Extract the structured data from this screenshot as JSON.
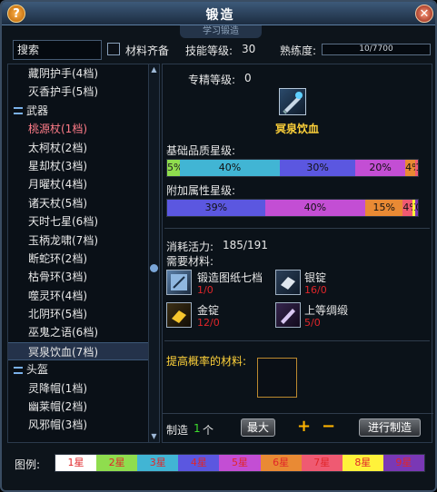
{
  "window": {
    "title": "锻造",
    "subtab": "学习锻造",
    "help_icon": "?"
  },
  "toolbar": {
    "search_value": "搜索",
    "materials_label": "材料齐备",
    "skill_label": "技能等级:",
    "skill_value": "30",
    "proficiency_label": "熟练度:",
    "proficiency_value": "10/7700",
    "proficiency_fraction": 0.0013
  },
  "sidebar": {
    "items": [
      {
        "label": "藏阴护手(4档)",
        "type": "item"
      },
      {
        "label": "灭香护手(5档)",
        "type": "item"
      },
      {
        "label": "武器",
        "type": "category"
      },
      {
        "label": "桃源杖(1档)",
        "type": "item",
        "pink": true
      },
      {
        "label": "太柯杖(2档)",
        "type": "item"
      },
      {
        "label": "星却杖(3档)",
        "type": "item"
      },
      {
        "label": "月曜杖(4档)",
        "type": "item"
      },
      {
        "label": "诸天杖(5档)",
        "type": "item"
      },
      {
        "label": "天时七星(6档)",
        "type": "item"
      },
      {
        "label": "玉柄龙啸(7档)",
        "type": "item"
      },
      {
        "label": "断蛇环(2档)",
        "type": "item"
      },
      {
        "label": "枯骨环(3档)",
        "type": "item"
      },
      {
        "label": "噬灵环(4档)",
        "type": "item"
      },
      {
        "label": "北阴环(5档)",
        "type": "item"
      },
      {
        "label": "巫鬼之语(6档)",
        "type": "item"
      },
      {
        "label": "冥泉饮血(7档)",
        "type": "item",
        "selected": true
      },
      {
        "label": "头盔",
        "type": "category"
      },
      {
        "label": "灵降帽(1档)",
        "type": "item"
      },
      {
        "label": "幽莱帽(2档)",
        "type": "item"
      },
      {
        "label": "风邪帽(3档)",
        "type": "item"
      }
    ]
  },
  "detail": {
    "specialty_label": "专精等级:",
    "specialty_value": "0",
    "item_name": "冥泉饮血",
    "base_quality_label": "基础品质星级:",
    "base_quality": [
      {
        "label": "5%",
        "percent": 5,
        "color": "#8fdd4e"
      },
      {
        "label": "40%",
        "percent": 40,
        "color": "#41b5d4"
      },
      {
        "label": "30%",
        "percent": 30,
        "color": "#5b57e0"
      },
      {
        "label": "20%",
        "percent": 20,
        "color": "#c34ed4"
      },
      {
        "label": "4%",
        "percent": 4,
        "color": "#e98a34"
      },
      {
        "label": "1%",
        "percent": 1,
        "color": "#ef5a72"
      }
    ],
    "extra_quality_label": "附加属性星级:",
    "extra_quality": [
      {
        "label": "39%",
        "percent": 39,
        "color": "#5b57e0"
      },
      {
        "label": "40%",
        "percent": 40,
        "color": "#c34ed4"
      },
      {
        "label": "15%",
        "percent": 15,
        "color": "#e98a34"
      },
      {
        "label": "4%",
        "percent": 4,
        "color": "#ef5a72"
      },
      {
        "label": "1%",
        "percent": 1,
        "color": "#fff23a"
      },
      {
        "label": "0%",
        "percent": 1,
        "color": "#7a38b5"
      }
    ],
    "vitality_label": "消耗活力:",
    "vitality_value": "185/191",
    "materials_label": "需要材料:",
    "materials": [
      {
        "name": "锻造图纸七档",
        "count": "1/0",
        "icon": "blueprint-icon"
      },
      {
        "name": "银锭",
        "count": "16/0",
        "icon": "silver-ingot-icon"
      },
      {
        "name": "金锭",
        "count": "12/0",
        "icon": "gold-ingot-icon"
      },
      {
        "name": "上等绸缎",
        "count": "5/0",
        "icon": "silk-icon"
      }
    ],
    "rate_label": "提高概率的材料:",
    "make_label": "制造",
    "make_qty": "1",
    "make_unit": "个",
    "max_button": "最大",
    "plus": "+",
    "minus": "−",
    "forge_button": "进行制造"
  },
  "legend": {
    "label": "图例:",
    "levels": [
      {
        "label": "1星",
        "color": "#ffffff",
        "text_color": "#e0262a"
      },
      {
        "label": "2星",
        "color": "#8fdd4e",
        "text_color": "#e0262a"
      },
      {
        "label": "3星",
        "color": "#41b5d4",
        "text_color": "#e0262a"
      },
      {
        "label": "4星",
        "color": "#5b57e0",
        "text_color": "#e0262a"
      },
      {
        "label": "5星",
        "color": "#c34ed4",
        "text_color": "#e0262a"
      },
      {
        "label": "6星",
        "color": "#e98a34",
        "text_color": "#e0262a"
      },
      {
        "label": "7星",
        "color": "#ef5a72",
        "text_color": "#e0262a"
      },
      {
        "label": "8星",
        "color": "#fff23a",
        "text_color": "#e0262a"
      },
      {
        "label": "9星",
        "color": "#7a38b5",
        "text_color": "#e0262a"
      }
    ]
  }
}
